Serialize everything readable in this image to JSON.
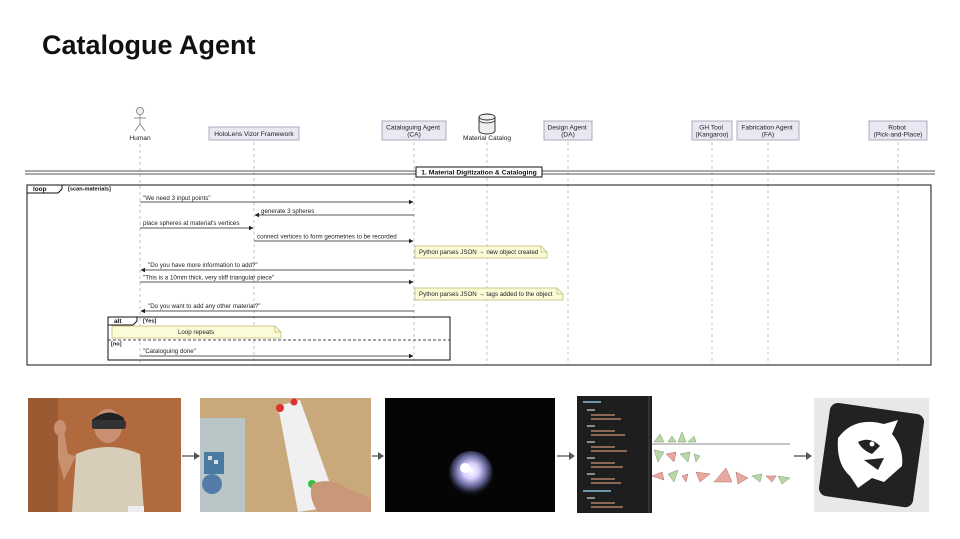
{
  "slide": {
    "title": "Catalogue Agent"
  },
  "sequence": {
    "participants": [
      {
        "id": "human",
        "label": "Human",
        "kind": "actor"
      },
      {
        "id": "hololens",
        "label": "HoloLens Vizor Framework",
        "kind": "box"
      },
      {
        "id": "ca",
        "label": "Cataloguing Agent\n(CA)",
        "kind": "box"
      },
      {
        "id": "catalog",
        "label": "Material Catalog",
        "kind": "database"
      },
      {
        "id": "da",
        "label": "Design Agent\n(DA)",
        "kind": "box"
      },
      {
        "id": "gh",
        "label": "GH Tool\n(Kangaroo)",
        "kind": "box"
      },
      {
        "id": "fa",
        "label": "Fabrication Agent\n(FA)",
        "kind": "box"
      },
      {
        "id": "robot",
        "label": "Robot\n(Pick-and-Place)",
        "kind": "box"
      }
    ],
    "section": "1. Material Digitization & Cataloging",
    "loop": {
      "label": "loop",
      "guard": "[scan-materials]"
    },
    "messages": [
      {
        "from": "human",
        "to": "ca",
        "text": "\"We need 3 input points\""
      },
      {
        "from": "ca",
        "to": "hololens",
        "text": "generate 3 spheres"
      },
      {
        "from": "human",
        "to": "hololens",
        "text": "place spheres at material's vertices"
      },
      {
        "from": "hololens",
        "to": "ca",
        "text": "connect vertices to form geometries to be recorded"
      },
      {
        "note": "Python parses JSON →  new object created"
      },
      {
        "from": "ca",
        "to": "human",
        "text": "\"Do you have more information to add?\""
      },
      {
        "from": "human",
        "to": "ca",
        "text": "\"This is a 10mm thick, very stiff triangular piece\""
      },
      {
        "note": "Python parses JSON →  tags added to the object"
      },
      {
        "from": "ca",
        "to": "human",
        "text": "\"Do you want to add any other material?\""
      }
    ],
    "alt": {
      "label": "alt",
      "guard_yes": "[Yes]",
      "note_yes": "Loop repeats",
      "guard_no": "[no]",
      "message_no": "\"Cataloguing done\""
    }
  },
  "pipeline": {
    "steps": [
      {
        "name": "person-with-headset-photo"
      },
      {
        "name": "hand-placing-spheres-photo"
      },
      {
        "name": "glowing-sphere-photo"
      },
      {
        "name": "json-code-screenshot"
      },
      {
        "name": "material-fragments-diagram"
      },
      {
        "name": "rhino-logo"
      }
    ],
    "colors": {
      "arrow": "#555555",
      "fragment_green": "#b8d8a8",
      "fragment_pink": "#e8a8a0",
      "code_bg": "#1e1e1e",
      "json_key": "#9cdcfe",
      "json_string": "#ce9178"
    }
  }
}
